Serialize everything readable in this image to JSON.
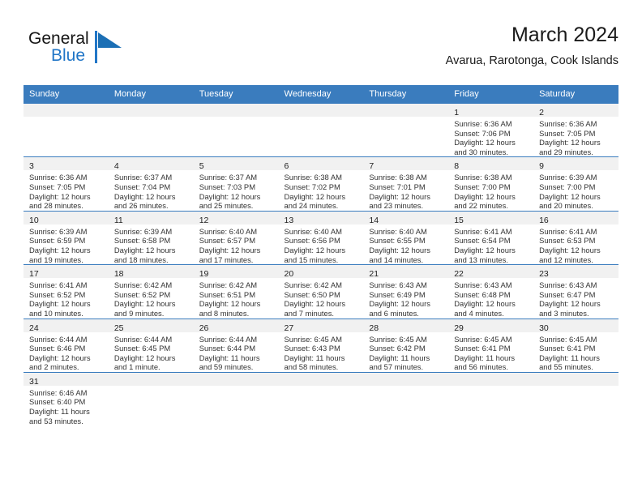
{
  "brand": {
    "name_part1": "General",
    "name_part2": "Blue",
    "logo_icon": "triangle-flag-icon",
    "color_primary": "#2176c7",
    "color_dark": "#161616"
  },
  "header": {
    "title": "March 2024",
    "subtitle": "Avarua, Rarotonga, Cook Islands"
  },
  "calendar": {
    "accent_color": "#3a7cbe",
    "daynum_band_color": "#f1f1f1",
    "weekday_headers": [
      "Sunday",
      "Monday",
      "Tuesday",
      "Wednesday",
      "Thursday",
      "Friday",
      "Saturday"
    ],
    "weeks": [
      [
        {
          "day": "",
          "empty": true,
          "lines": [
            "",
            "",
            "",
            ""
          ]
        },
        {
          "day": "",
          "empty": true,
          "lines": [
            "",
            "",
            "",
            ""
          ]
        },
        {
          "day": "",
          "empty": true,
          "lines": [
            "",
            "",
            "",
            ""
          ]
        },
        {
          "day": "",
          "empty": true,
          "lines": [
            "",
            "",
            "",
            ""
          ]
        },
        {
          "day": "",
          "empty": true,
          "lines": [
            "",
            "",
            "",
            ""
          ]
        },
        {
          "day": "1",
          "empty": false,
          "lines": [
            "Sunrise: 6:36 AM",
            "Sunset: 7:06 PM",
            "Daylight: 12 hours",
            "and 30 minutes."
          ]
        },
        {
          "day": "2",
          "empty": false,
          "lines": [
            "Sunrise: 6:36 AM",
            "Sunset: 7:05 PM",
            "Daylight: 12 hours",
            "and 29 minutes."
          ]
        }
      ],
      [
        {
          "day": "3",
          "empty": false,
          "lines": [
            "Sunrise: 6:36 AM",
            "Sunset: 7:05 PM",
            "Daylight: 12 hours",
            "and 28 minutes."
          ]
        },
        {
          "day": "4",
          "empty": false,
          "lines": [
            "Sunrise: 6:37 AM",
            "Sunset: 7:04 PM",
            "Daylight: 12 hours",
            "and 26 minutes."
          ]
        },
        {
          "day": "5",
          "empty": false,
          "lines": [
            "Sunrise: 6:37 AM",
            "Sunset: 7:03 PM",
            "Daylight: 12 hours",
            "and 25 minutes."
          ]
        },
        {
          "day": "6",
          "empty": false,
          "lines": [
            "Sunrise: 6:38 AM",
            "Sunset: 7:02 PM",
            "Daylight: 12 hours",
            "and 24 minutes."
          ]
        },
        {
          "day": "7",
          "empty": false,
          "lines": [
            "Sunrise: 6:38 AM",
            "Sunset: 7:01 PM",
            "Daylight: 12 hours",
            "and 23 minutes."
          ]
        },
        {
          "day": "8",
          "empty": false,
          "lines": [
            "Sunrise: 6:38 AM",
            "Sunset: 7:00 PM",
            "Daylight: 12 hours",
            "and 22 minutes."
          ]
        },
        {
          "day": "9",
          "empty": false,
          "lines": [
            "Sunrise: 6:39 AM",
            "Sunset: 7:00 PM",
            "Daylight: 12 hours",
            "and 20 minutes."
          ]
        }
      ],
      [
        {
          "day": "10",
          "empty": false,
          "lines": [
            "Sunrise: 6:39 AM",
            "Sunset: 6:59 PM",
            "Daylight: 12 hours",
            "and 19 minutes."
          ]
        },
        {
          "day": "11",
          "empty": false,
          "lines": [
            "Sunrise: 6:39 AM",
            "Sunset: 6:58 PM",
            "Daylight: 12 hours",
            "and 18 minutes."
          ]
        },
        {
          "day": "12",
          "empty": false,
          "lines": [
            "Sunrise: 6:40 AM",
            "Sunset: 6:57 PM",
            "Daylight: 12 hours",
            "and 17 minutes."
          ]
        },
        {
          "day": "13",
          "empty": false,
          "lines": [
            "Sunrise: 6:40 AM",
            "Sunset: 6:56 PM",
            "Daylight: 12 hours",
            "and 15 minutes."
          ]
        },
        {
          "day": "14",
          "empty": false,
          "lines": [
            "Sunrise: 6:40 AM",
            "Sunset: 6:55 PM",
            "Daylight: 12 hours",
            "and 14 minutes."
          ]
        },
        {
          "day": "15",
          "empty": false,
          "lines": [
            "Sunrise: 6:41 AM",
            "Sunset: 6:54 PM",
            "Daylight: 12 hours",
            "and 13 minutes."
          ]
        },
        {
          "day": "16",
          "empty": false,
          "lines": [
            "Sunrise: 6:41 AM",
            "Sunset: 6:53 PM",
            "Daylight: 12 hours",
            "and 12 minutes."
          ]
        }
      ],
      [
        {
          "day": "17",
          "empty": false,
          "lines": [
            "Sunrise: 6:41 AM",
            "Sunset: 6:52 PM",
            "Daylight: 12 hours",
            "and 10 minutes."
          ]
        },
        {
          "day": "18",
          "empty": false,
          "lines": [
            "Sunrise: 6:42 AM",
            "Sunset: 6:52 PM",
            "Daylight: 12 hours",
            "and 9 minutes."
          ]
        },
        {
          "day": "19",
          "empty": false,
          "lines": [
            "Sunrise: 6:42 AM",
            "Sunset: 6:51 PM",
            "Daylight: 12 hours",
            "and 8 minutes."
          ]
        },
        {
          "day": "20",
          "empty": false,
          "lines": [
            "Sunrise: 6:42 AM",
            "Sunset: 6:50 PM",
            "Daylight: 12 hours",
            "and 7 minutes."
          ]
        },
        {
          "day": "21",
          "empty": false,
          "lines": [
            "Sunrise: 6:43 AM",
            "Sunset: 6:49 PM",
            "Daylight: 12 hours",
            "and 6 minutes."
          ]
        },
        {
          "day": "22",
          "empty": false,
          "lines": [
            "Sunrise: 6:43 AM",
            "Sunset: 6:48 PM",
            "Daylight: 12 hours",
            "and 4 minutes."
          ]
        },
        {
          "day": "23",
          "empty": false,
          "lines": [
            "Sunrise: 6:43 AM",
            "Sunset: 6:47 PM",
            "Daylight: 12 hours",
            "and 3 minutes."
          ]
        }
      ],
      [
        {
          "day": "24",
          "empty": false,
          "lines": [
            "Sunrise: 6:44 AM",
            "Sunset: 6:46 PM",
            "Daylight: 12 hours",
            "and 2 minutes."
          ]
        },
        {
          "day": "25",
          "empty": false,
          "lines": [
            "Sunrise: 6:44 AM",
            "Sunset: 6:45 PM",
            "Daylight: 12 hours",
            "and 1 minute."
          ]
        },
        {
          "day": "26",
          "empty": false,
          "lines": [
            "Sunrise: 6:44 AM",
            "Sunset: 6:44 PM",
            "Daylight: 11 hours",
            "and 59 minutes."
          ]
        },
        {
          "day": "27",
          "empty": false,
          "lines": [
            "Sunrise: 6:45 AM",
            "Sunset: 6:43 PM",
            "Daylight: 11 hours",
            "and 58 minutes."
          ]
        },
        {
          "day": "28",
          "empty": false,
          "lines": [
            "Sunrise: 6:45 AM",
            "Sunset: 6:42 PM",
            "Daylight: 11 hours",
            "and 57 minutes."
          ]
        },
        {
          "day": "29",
          "empty": false,
          "lines": [
            "Sunrise: 6:45 AM",
            "Sunset: 6:41 PM",
            "Daylight: 11 hours",
            "and 56 minutes."
          ]
        },
        {
          "day": "30",
          "empty": false,
          "lines": [
            "Sunrise: 6:45 AM",
            "Sunset: 6:41 PM",
            "Daylight: 11 hours",
            "and 55 minutes."
          ]
        }
      ],
      [
        {
          "day": "31",
          "empty": false,
          "lines": [
            "Sunrise: 6:46 AM",
            "Sunset: 6:40 PM",
            "Daylight: 11 hours",
            "and 53 minutes."
          ]
        },
        {
          "day": "",
          "empty": true,
          "lines": [
            "",
            "",
            "",
            ""
          ]
        },
        {
          "day": "",
          "empty": true,
          "lines": [
            "",
            "",
            "",
            ""
          ]
        },
        {
          "day": "",
          "empty": true,
          "lines": [
            "",
            "",
            "",
            ""
          ]
        },
        {
          "day": "",
          "empty": true,
          "lines": [
            "",
            "",
            "",
            ""
          ]
        },
        {
          "day": "",
          "empty": true,
          "lines": [
            "",
            "",
            "",
            ""
          ]
        },
        {
          "day": "",
          "empty": true,
          "lines": [
            "",
            "",
            "",
            ""
          ]
        }
      ]
    ]
  }
}
